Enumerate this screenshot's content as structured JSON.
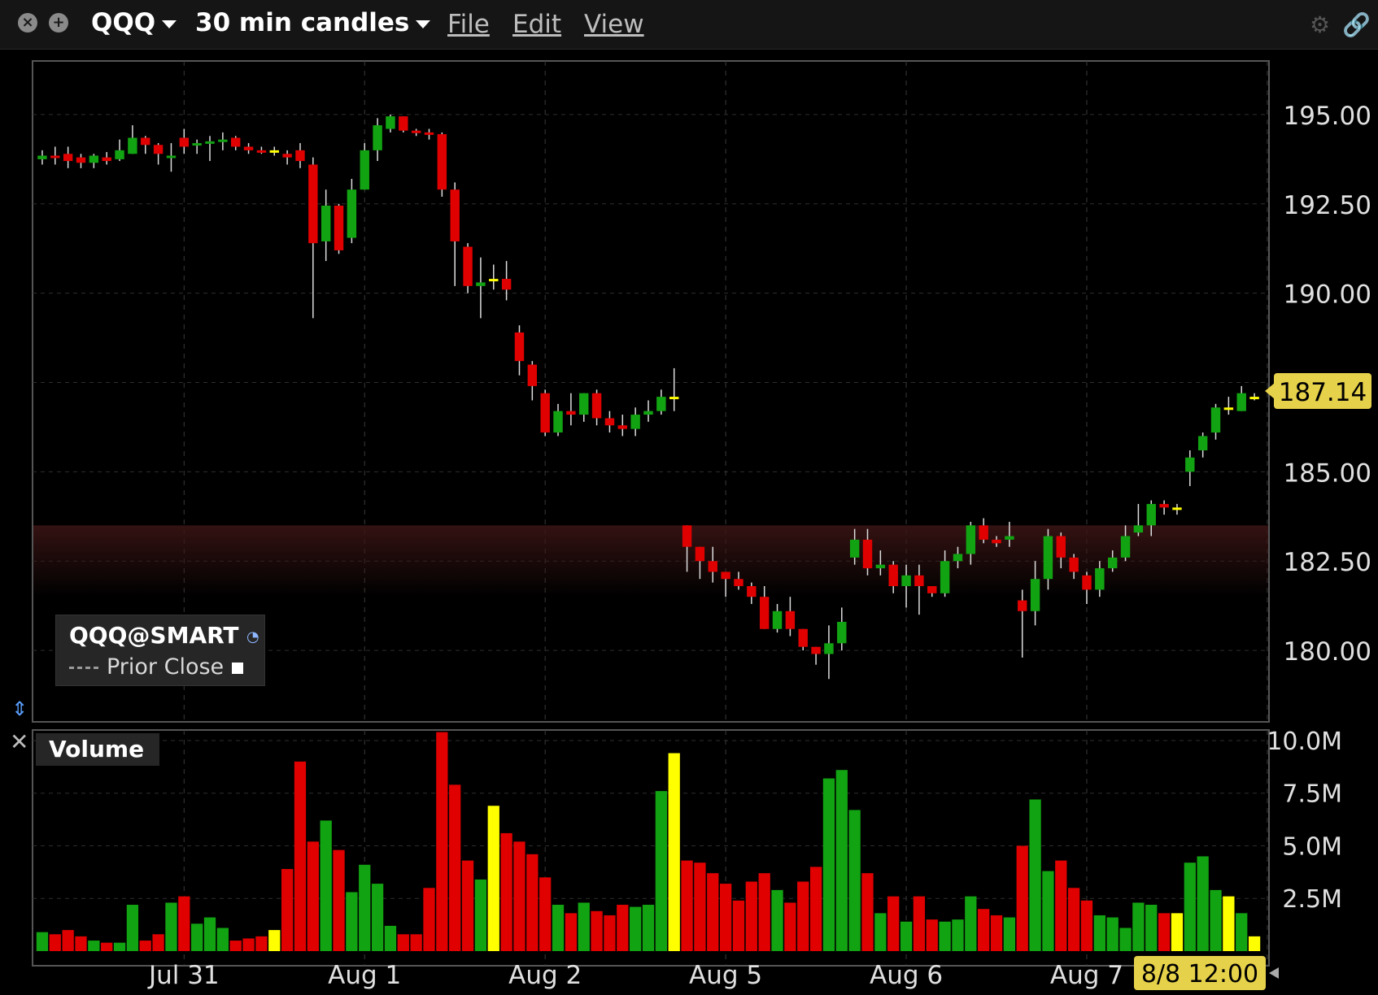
{
  "window": {
    "symbol": "QQQ",
    "interval": "30 min candles",
    "menu": [
      "File",
      "Edit",
      "View"
    ],
    "icons": [
      "close-icon",
      "add-icon",
      "gear-icon",
      "link-icon"
    ]
  },
  "legend": {
    "symbol": "QQQ@SMART",
    "prior_close": "Prior Close"
  },
  "volume_panel": {
    "label": "Volume"
  },
  "last_price_label": "187.14",
  "time_cursor_label": "8/8 12:00",
  "colors": {
    "up": "#12a312",
    "down": "#e00000",
    "flat": "#ffff00",
    "last_price_bg": "#e6d14a",
    "band": "#3a1414"
  },
  "chart_data": [
    {
      "type": "candlestick",
      "title": "QQQ 30 min candles",
      "ylim": [
        178,
        196.5
      ],
      "y_ticks": [
        "195.00",
        "192.50",
        "190.00",
        "187.50",
        "185.00",
        "182.50",
        "180.00"
      ],
      "x_ticks": [
        "Jul 31",
        "Aug 1",
        "Aug 2",
        "Aug 5",
        "Aug 6",
        "Aug 7"
      ],
      "prior_close_band": [
        181.5,
        183.5
      ],
      "candles": [
        [
          193.75,
          193.85,
          194.0,
          193.6
        ],
        [
          193.85,
          193.8,
          194.1,
          193.6
        ],
        [
          193.9,
          193.7,
          194.1,
          193.5
        ],
        [
          193.8,
          193.65,
          193.9,
          193.5
        ],
        [
          193.65,
          193.85,
          193.9,
          193.5
        ],
        [
          193.8,
          193.7,
          193.95,
          193.6
        ],
        [
          193.75,
          194.0,
          194.3,
          193.7
        ],
        [
          193.9,
          194.35,
          194.7,
          193.9
        ],
        [
          194.35,
          194.15,
          194.4,
          193.9
        ],
        [
          194.15,
          193.9,
          194.2,
          193.6
        ],
        [
          193.8,
          193.85,
          194.2,
          193.4
        ],
        [
          194.35,
          194.1,
          194.6,
          193.9
        ],
        [
          194.15,
          194.2,
          194.3,
          193.9
        ],
        [
          194.2,
          194.25,
          194.4,
          193.7
        ],
        [
          194.25,
          194.3,
          194.5,
          194.0
        ],
        [
          194.35,
          194.1,
          194.4,
          194.0
        ],
        [
          194.1,
          194.0,
          194.2,
          193.9
        ],
        [
          194.0,
          193.95,
          194.1,
          193.9
        ],
        [
          194.0,
          194.0,
          194.1,
          193.85
        ],
        [
          193.9,
          193.8,
          194.0,
          193.6
        ],
        [
          194.0,
          193.7,
          194.2,
          193.5
        ],
        [
          193.6,
          191.4,
          193.8,
          189.3
        ],
        [
          191.45,
          192.45,
          192.9,
          190.9
        ],
        [
          192.45,
          191.2,
          192.5,
          191.1
        ],
        [
          191.55,
          192.9,
          193.2,
          191.4
        ],
        [
          192.9,
          194.0,
          194.2,
          192.9
        ],
        [
          194.0,
          194.7,
          194.9,
          193.7
        ],
        [
          194.6,
          194.95,
          195.0,
          194.5
        ],
        [
          194.95,
          194.55,
          194.95,
          194.5
        ],
        [
          194.55,
          194.5,
          194.6,
          194.4
        ],
        [
          194.5,
          194.45,
          194.6,
          194.3
        ],
        [
          194.45,
          192.9,
          194.5,
          192.7
        ],
        [
          192.9,
          191.45,
          193.1,
          190.2
        ],
        [
          191.3,
          190.2,
          191.4,
          190.0
        ],
        [
          190.2,
          190.3,
          191.0,
          189.3
        ],
        [
          190.4,
          190.4,
          190.8,
          190.1
        ],
        [
          190.4,
          190.1,
          190.9,
          189.8
        ],
        [
          188.9,
          188.1,
          189.1,
          187.7
        ],
        [
          188.0,
          187.4,
          188.1,
          187.0
        ],
        [
          187.2,
          186.1,
          187.3,
          186.0
        ],
        [
          186.1,
          186.7,
          186.9,
          186.0
        ],
        [
          186.7,
          186.6,
          187.2,
          186.3
        ],
        [
          186.6,
          187.2,
          187.2,
          186.4
        ],
        [
          187.2,
          186.5,
          187.3,
          186.3
        ],
        [
          186.5,
          186.3,
          186.7,
          186.1
        ],
        [
          186.3,
          186.2,
          186.6,
          186.0
        ],
        [
          186.2,
          186.6,
          186.8,
          186.0
        ],
        [
          186.6,
          186.7,
          187.0,
          186.4
        ],
        [
          186.7,
          187.1,
          187.3,
          186.6
        ],
        [
          187.1,
          187.1,
          187.9,
          186.7
        ],
        [
          183.5,
          182.9,
          183.5,
          182.2
        ],
        [
          182.9,
          182.5,
          182.9,
          182.0
        ],
        [
          182.5,
          182.2,
          182.9,
          181.9
        ],
        [
          182.2,
          182.0,
          182.2,
          181.5
        ],
        [
          182.0,
          181.8,
          182.2,
          181.7
        ],
        [
          181.8,
          181.5,
          181.9,
          181.3
        ],
        [
          181.5,
          180.6,
          181.8,
          180.6
        ],
        [
          180.6,
          181.1,
          181.3,
          180.5
        ],
        [
          181.1,
          180.6,
          181.5,
          180.4
        ],
        [
          180.6,
          180.1,
          180.6,
          180.0
        ],
        [
          180.1,
          179.9,
          180.1,
          179.6
        ],
        [
          179.9,
          180.2,
          180.7,
          179.2
        ],
        [
          180.2,
          180.8,
          181.2,
          180.0
        ],
        [
          182.6,
          183.1,
          183.4,
          182.4
        ],
        [
          183.1,
          182.3,
          183.4,
          182.1
        ],
        [
          182.3,
          182.4,
          182.8,
          182.1
        ],
        [
          182.4,
          181.8,
          182.5,
          181.6
        ],
        [
          181.8,
          182.1,
          182.4,
          181.2
        ],
        [
          182.1,
          181.8,
          182.4,
          181.0
        ],
        [
          181.8,
          181.6,
          181.8,
          181.5
        ],
        [
          181.6,
          182.5,
          182.8,
          181.5
        ],
        [
          182.5,
          182.7,
          182.9,
          182.3
        ],
        [
          182.7,
          183.5,
          183.6,
          182.4
        ],
        [
          183.5,
          183.1,
          183.7,
          183.0
        ],
        [
          183.1,
          183.0,
          183.2,
          182.9
        ],
        [
          183.1,
          183.2,
          183.6,
          182.9
        ],
        [
          181.4,
          181.1,
          181.7,
          179.8
        ],
        [
          181.1,
          182.0,
          182.5,
          180.7
        ],
        [
          182.0,
          183.2,
          183.4,
          181.7
        ],
        [
          183.2,
          182.6,
          183.3,
          182.3
        ],
        [
          182.6,
          182.2,
          182.7,
          182.0
        ],
        [
          182.1,
          181.7,
          182.2,
          181.3
        ],
        [
          181.7,
          182.3,
          182.5,
          181.5
        ],
        [
          182.3,
          182.6,
          182.8,
          182.2
        ],
        [
          182.6,
          183.2,
          183.5,
          182.5
        ],
        [
          183.3,
          183.5,
          184.1,
          183.2
        ],
        [
          183.5,
          184.1,
          184.2,
          183.2
        ],
        [
          184.1,
          184.0,
          184.2,
          183.8
        ],
        [
          184.0,
          184.0,
          184.1,
          183.8
        ],
        [
          185.0,
          185.4,
          185.6,
          184.6
        ],
        [
          185.6,
          186.0,
          186.1,
          185.4
        ],
        [
          186.1,
          186.8,
          186.9,
          185.9
        ],
        [
          186.8,
          186.8,
          187.1,
          186.6
        ],
        [
          186.7,
          187.2,
          187.4,
          186.7
        ],
        [
          187.1,
          187.1,
          187.2,
          187.0
        ]
      ],
      "volume": {
        "ylim": [
          0,
          10.5
        ],
        "y_ticks": [
          "10.0M",
          "7.5M",
          "5.0M",
          "2.5M"
        ],
        "values": [
          0.9,
          0.8,
          1.0,
          0.7,
          0.5,
          0.4,
          0.4,
          2.2,
          0.5,
          0.8,
          2.3,
          2.6,
          1.3,
          1.6,
          1.1,
          0.5,
          0.6,
          0.7,
          1.0,
          3.9,
          9.0,
          5.2,
          6.2,
          4.8,
          2.8,
          4.1,
          3.2,
          1.2,
          0.8,
          0.8,
          3.0,
          10.4,
          7.9,
          4.3,
          3.4,
          6.9,
          5.6,
          5.2,
          4.6,
          3.5,
          2.2,
          1.8,
          2.3,
          1.9,
          1.7,
          2.2,
          2.1,
          2.2,
          7.6,
          9.4,
          4.3,
          4.2,
          3.7,
          3.2,
          2.4,
          3.3,
          3.7,
          2.9,
          2.3,
          3.3,
          4.0,
          8.2,
          8.6,
          6.7,
          3.7,
          1.8,
          2.6,
          1.4,
          2.6,
          1.5,
          1.4,
          1.5,
          2.6,
          2.0,
          1.7,
          1.6,
          5.0,
          7.2,
          3.8,
          4.3,
          3.0,
          2.4,
          1.7,
          1.6,
          1.1,
          2.3,
          2.2,
          1.8,
          1.8,
          4.2,
          4.5,
          2.9,
          2.6,
          1.8,
          0.7
        ]
      }
    }
  ]
}
